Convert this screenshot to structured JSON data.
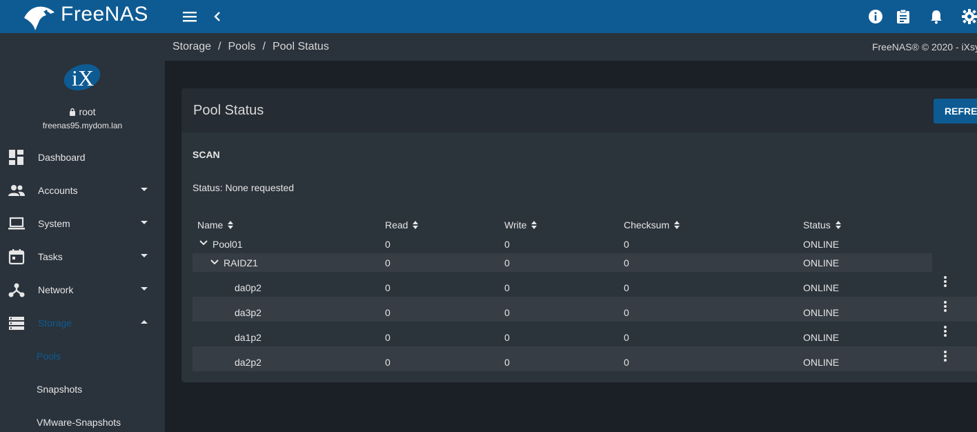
{
  "topbar": {
    "brand": "FreeNAS",
    "menu_icon": "hamburger-menu-icon",
    "back_icon": "chevron-left-icon",
    "right_icons": [
      "info-icon",
      "clipboard-icon",
      "bell-icon",
      "gear-icon"
    ],
    "color": "#0e5b93"
  },
  "sidebar": {
    "user": "root",
    "host": "freenas95.mydom.lan",
    "items": [
      {
        "label": "Dashboard",
        "icon": "dashboard-icon",
        "caret": "none"
      },
      {
        "label": "Accounts",
        "icon": "accounts-icon",
        "caret": "down"
      },
      {
        "label": "System",
        "icon": "laptop-icon",
        "caret": "down"
      },
      {
        "label": "Tasks",
        "icon": "calendar-icon",
        "caret": "down"
      },
      {
        "label": "Network",
        "icon": "network-icon",
        "caret": "down"
      },
      {
        "label": "Storage",
        "icon": "storage-icon",
        "caret": "up",
        "active": true
      }
    ],
    "storage_sub": [
      "Pools",
      "Snapshots",
      "VMware-Snapshots"
    ],
    "active_color": "#0e5b93"
  },
  "breadcrumb": {
    "items": [
      "Storage",
      "Pools",
      "Pool Status"
    ],
    "separator": "/",
    "copyright": "FreeNAS® © 2020 - iXsy"
  },
  "card": {
    "title": "Pool Status",
    "refresh_label": "REFRESH",
    "scan_label": "SCAN",
    "status_text": "Status: None requested",
    "columns": [
      "Name",
      "Read",
      "Write",
      "Checksum",
      "Status"
    ],
    "rows": [
      {
        "name": "Pool01",
        "read": "0",
        "write": "0",
        "checksum": "0",
        "status": "ONLINE",
        "expander": true,
        "indent": 0,
        "menu": false
      },
      {
        "name": "RAIDZ1",
        "read": "0",
        "write": "0",
        "checksum": "0",
        "status": "ONLINE",
        "expander": true,
        "indent": 1,
        "menu": false
      },
      {
        "name": "da0p2",
        "read": "0",
        "write": "0",
        "checksum": "0",
        "status": "ONLINE",
        "expander": false,
        "indent": 2,
        "menu": true
      },
      {
        "name": "da3p2",
        "read": "0",
        "write": "0",
        "checksum": "0",
        "status": "ONLINE",
        "expander": false,
        "indent": 2,
        "menu": true
      },
      {
        "name": "da1p2",
        "read": "0",
        "write": "0",
        "checksum": "0",
        "status": "ONLINE",
        "expander": false,
        "indent": 2,
        "menu": true
      },
      {
        "name": "da2p2",
        "read": "0",
        "write": "0",
        "checksum": "0",
        "status": "ONLINE",
        "expander": false,
        "indent": 2,
        "menu": true
      }
    ]
  }
}
